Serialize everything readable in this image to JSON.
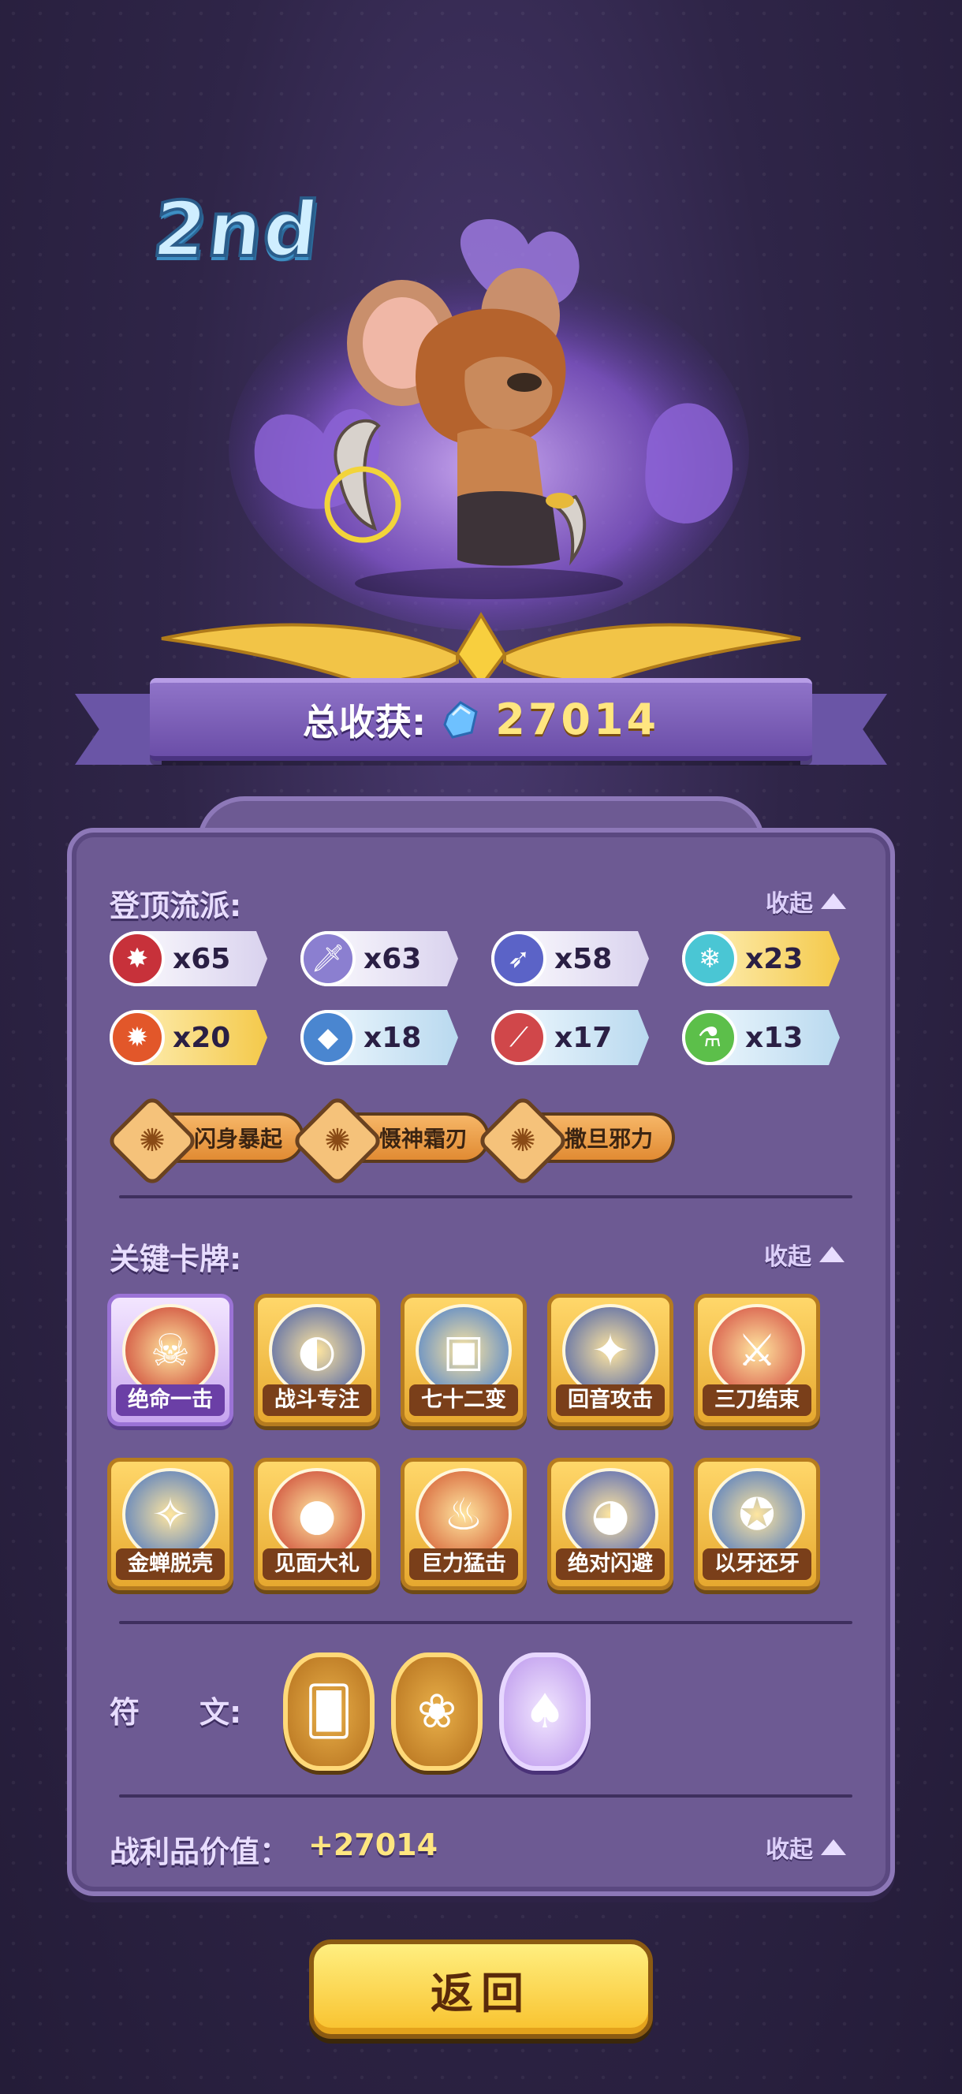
{
  "rank": "2nd",
  "total_harvest": {
    "label": "总收获:",
    "value": "27014",
    "currency_icon": "blue-gem-icon"
  },
  "styles_section": {
    "title": "登顶流派:",
    "collapse_label": "收起",
    "chips": [
      {
        "icon": "fire-claw-icon",
        "count": "x65",
        "tier": "silver",
        "color": "#c7313a"
      },
      {
        "icon": "dagger-icon",
        "count": "x63",
        "tier": "silver",
        "color": "#8b7fd0"
      },
      {
        "icon": "boot-icon",
        "count": "x58",
        "tier": "silver",
        "color": "#5b63c7"
      },
      {
        "icon": "snowflake-icon",
        "count": "x23",
        "tier": "gold",
        "color": "#4ac6d4"
      },
      {
        "icon": "flame-icon",
        "count": "x20",
        "tier": "gold",
        "color": "#e2572a"
      },
      {
        "icon": "water-drop-icon",
        "count": "x18",
        "tier": "blue",
        "color": "#4a86d0"
      },
      {
        "icon": "slash-icon",
        "count": "x17",
        "tier": "blue",
        "color": "#d0474a"
      },
      {
        "icon": "potion-icon",
        "count": "x13",
        "tier": "blue",
        "color": "#5cbf4a"
      }
    ],
    "skills": [
      "闪身暴起",
      "慑神霜刃",
      "撒旦邪力"
    ]
  },
  "cards_section": {
    "title": "关键卡牌:",
    "collapse_label": "收起",
    "cards": [
      {
        "name": "绝命一击",
        "rarity": "purple"
      },
      {
        "name": "战斗专注",
        "rarity": "gold"
      },
      {
        "name": "七十二变",
        "rarity": "gold"
      },
      {
        "name": "回音攻击",
        "rarity": "gold"
      },
      {
        "name": "三刀结束",
        "rarity": "gold"
      },
      {
        "name": "金蝉脱壳",
        "rarity": "gold"
      },
      {
        "name": "见面大礼",
        "rarity": "gold"
      },
      {
        "name": "巨力猛击",
        "rarity": "gold"
      },
      {
        "name": "绝对闪避",
        "rarity": "gold"
      },
      {
        "name": "以牙还牙",
        "rarity": "gold"
      }
    ]
  },
  "runes_section": {
    "title": "符　　文:",
    "runes": [
      {
        "icon": "card-feather-icon",
        "rarity": "gold"
      },
      {
        "icon": "rose-icon",
        "rarity": "gold"
      },
      {
        "icon": "card-spade-icon",
        "rarity": "purple"
      }
    ]
  },
  "loot_section": {
    "title": "战利品价值：",
    "value": "+27014",
    "collapse_label": "收起"
  },
  "back_button": "返回"
}
